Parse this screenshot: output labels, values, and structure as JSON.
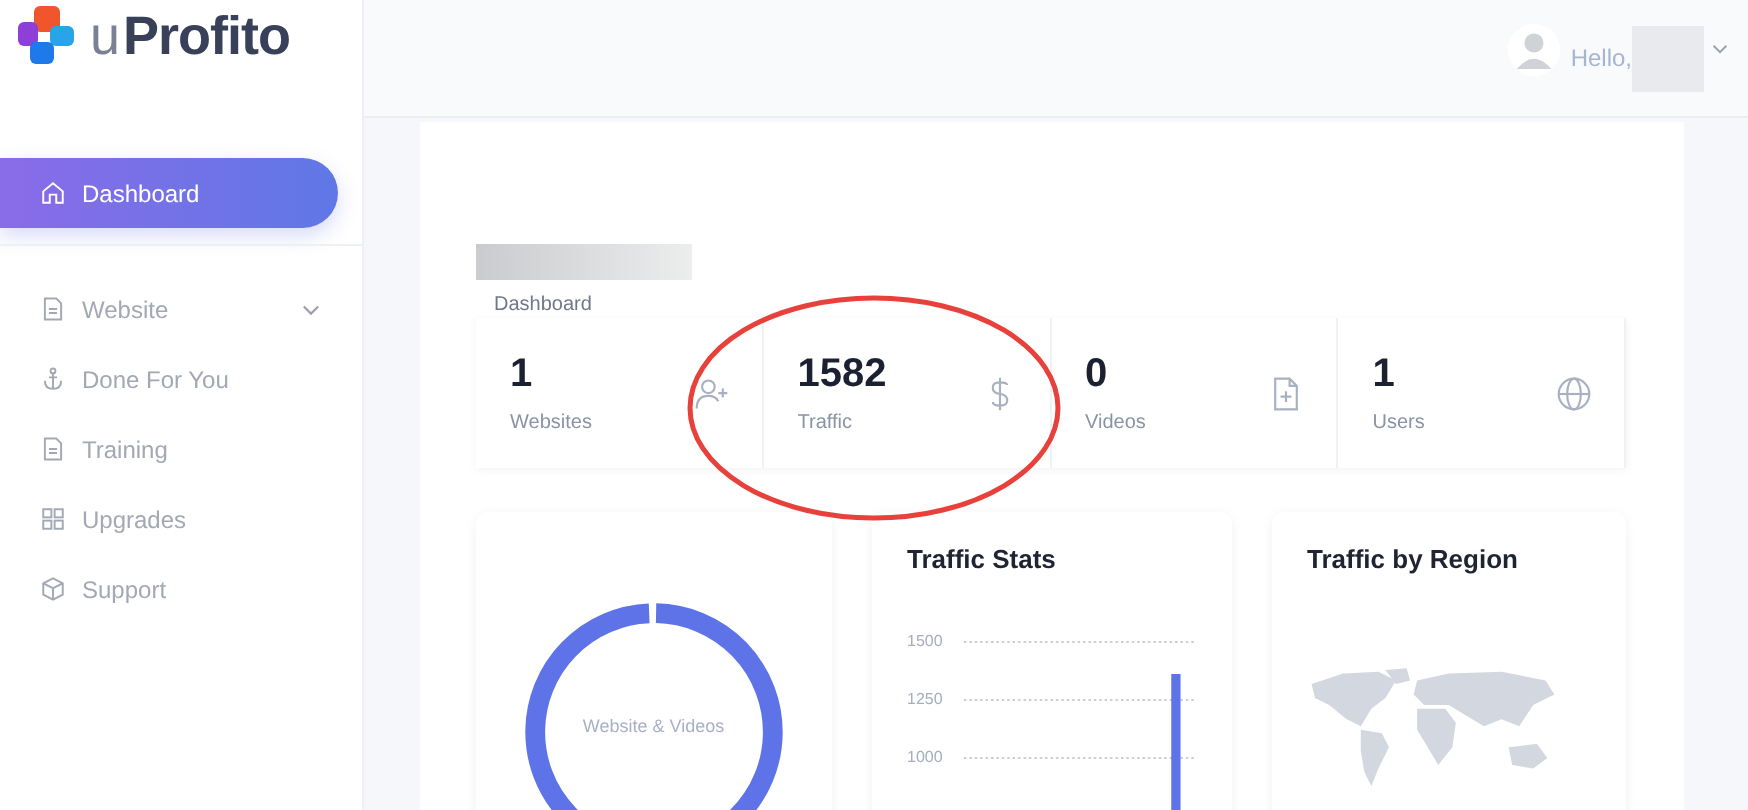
{
  "brand": {
    "prefix": "u",
    "name": "Profito"
  },
  "header": {
    "greeting": "Hello,"
  },
  "sidebar": {
    "items": [
      {
        "label": "Dashboard",
        "selected": true,
        "expandable": false
      },
      {
        "label": "Website",
        "selected": false,
        "expandable": true
      },
      {
        "label": "Done For You",
        "selected": false,
        "expandable": false
      },
      {
        "label": "Training",
        "selected": false,
        "expandable": false
      },
      {
        "label": "Upgrades",
        "selected": false,
        "expandable": false
      },
      {
        "label": "Support",
        "selected": false,
        "expandable": false
      }
    ]
  },
  "page": {
    "breadcrumb": "Dashboard"
  },
  "stats": [
    {
      "value": "1",
      "label": "Websites"
    },
    {
      "value": "1582",
      "label": "Traffic"
    },
    {
      "value": "0",
      "label": "Videos"
    },
    {
      "value": "1",
      "label": "Users"
    }
  ],
  "panels": {
    "donut_label": "Website & Videos",
    "traffic_title": "Traffic Stats",
    "region_title": "Traffic by Region",
    "axis_labels": [
      "1500",
      "1250",
      "1000"
    ]
  }
}
